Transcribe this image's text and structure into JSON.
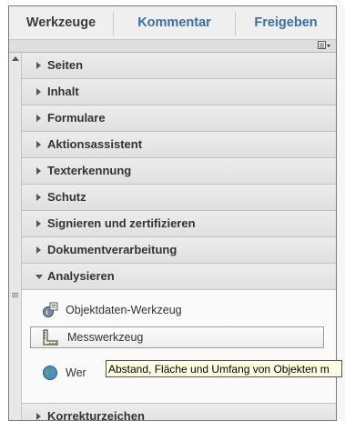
{
  "tabs": {
    "tools": "Werkzeuge",
    "comment": "Kommentar",
    "share": "Freigeben"
  },
  "panel_options_icon": "list-menu-icon",
  "sections": [
    {
      "label": "Seiten",
      "expanded": false
    },
    {
      "label": "Inhalt",
      "expanded": false
    },
    {
      "label": "Formulare",
      "expanded": false
    },
    {
      "label": "Aktionsassistent",
      "expanded": false
    },
    {
      "label": "Texterkennung",
      "expanded": false
    },
    {
      "label": "Schutz",
      "expanded": false
    },
    {
      "label": "Signieren und zertifizieren",
      "expanded": false
    },
    {
      "label": "Dokumentverarbeitung",
      "expanded": false
    },
    {
      "label": "Analysieren",
      "expanded": true
    },
    {
      "label": "Korrekturzeichen",
      "expanded": false
    }
  ],
  "analyze_tools": [
    {
      "label": "Objektdaten-Werkzeug",
      "icon": "object-data-icon"
    },
    {
      "label": "Messwerkzeug",
      "icon": "ruler-icon",
      "selected": true
    },
    {
      "label": "Wer",
      "icon": "globe-icon"
    }
  ],
  "tooltip": "Abstand, Fläche und Umfang von Objekten m"
}
